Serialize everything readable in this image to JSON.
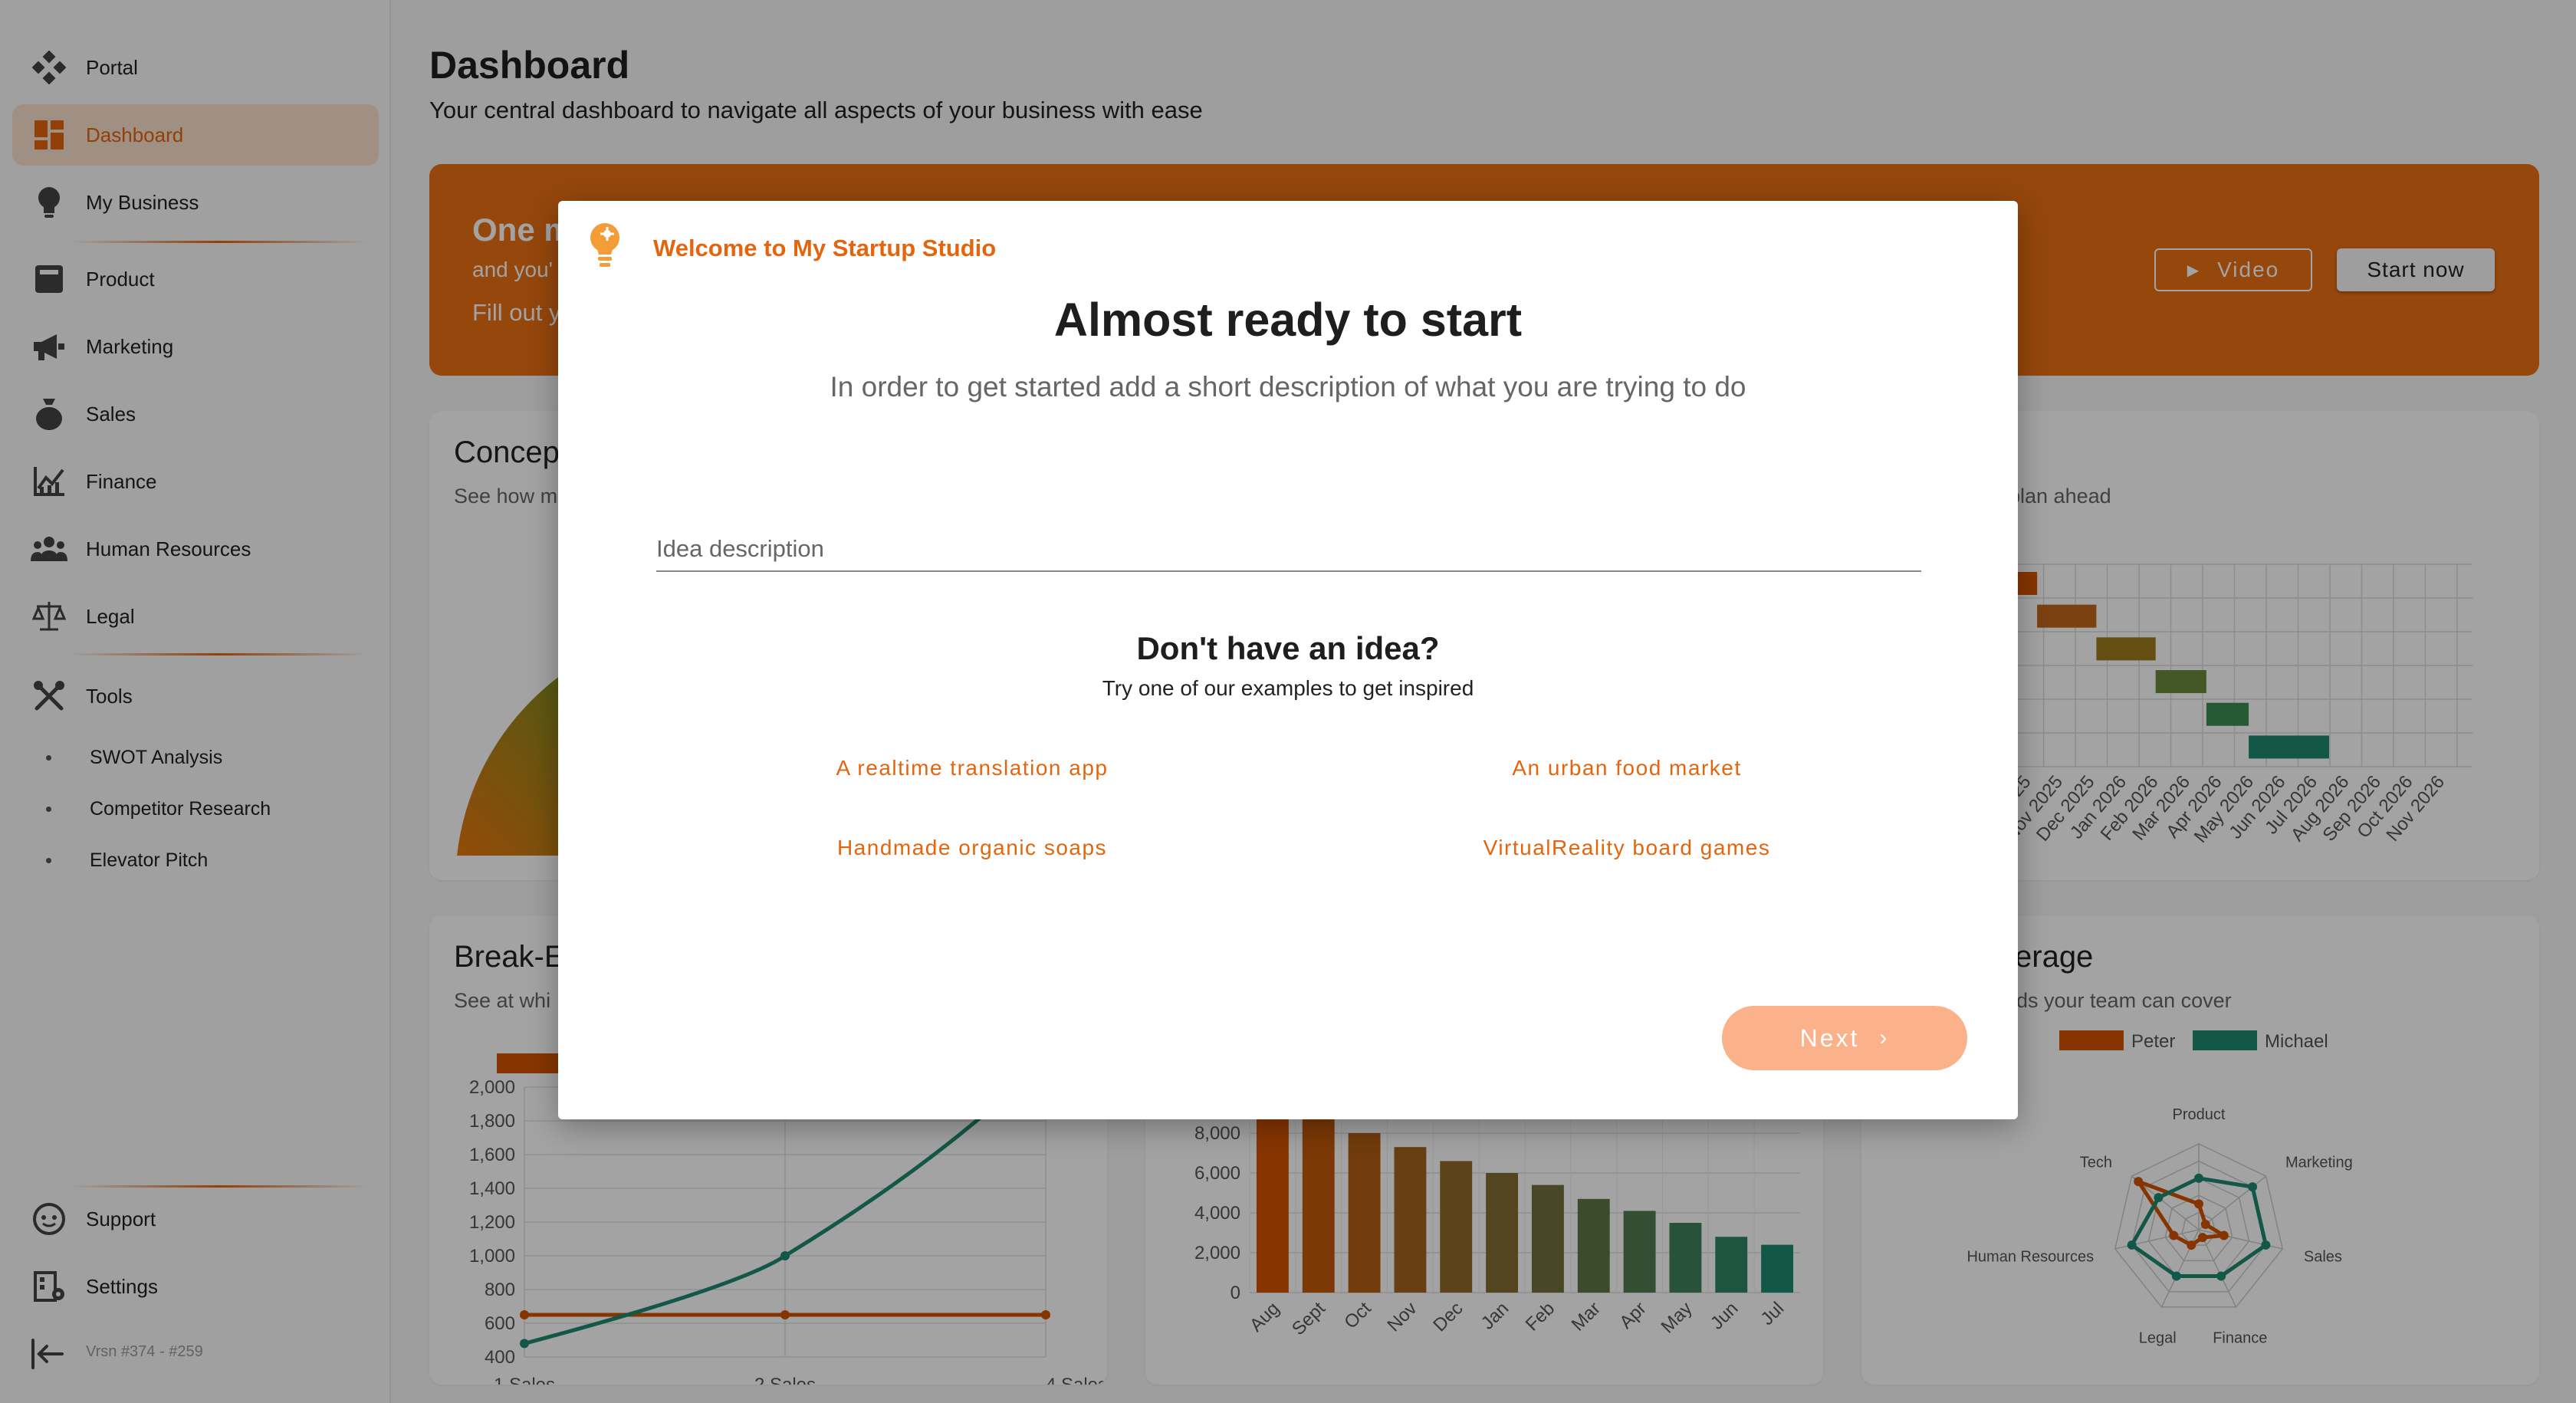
{
  "sidebar": {
    "items": [
      {
        "label": "Portal",
        "icon": "portal-icon"
      },
      {
        "label": "Dashboard",
        "icon": "dashboard-icon",
        "active": true
      },
      {
        "label": "My Business",
        "icon": "lightbulb-icon"
      },
      {
        "label": "Product",
        "icon": "product-icon"
      },
      {
        "label": "Marketing",
        "icon": "megaphone-icon"
      },
      {
        "label": "Sales",
        "icon": "money-bag-icon"
      },
      {
        "label": "Finance",
        "icon": "finance-chart-icon"
      },
      {
        "label": "Human Resources",
        "icon": "people-icon"
      },
      {
        "label": "Legal",
        "icon": "scales-icon"
      },
      {
        "label": "Tools",
        "icon": "tools-icon"
      }
    ],
    "tools": [
      "SWOT Analysis",
      "Competitor Research",
      "Elevator Pitch"
    ],
    "bottom": [
      {
        "label": "Support",
        "icon": "support-icon"
      },
      {
        "label": "Settings",
        "icon": "settings-icon"
      }
    ],
    "collapse_icon": "collapse-icon",
    "version": "Vrsn #374 - #259"
  },
  "header": {
    "title": "Dashboard",
    "subtitle": "Your central dashboard to navigate all aspects of your business with ease"
  },
  "banner": {
    "title": "One m",
    "line2": "and you'",
    "line3": "Fill out y",
    "video_label": "Video",
    "start_label": "Start now"
  },
  "cards": {
    "concept": {
      "title": "Concep",
      "subtitle": "See how m"
    },
    "timeline": {
      "subtitle": "plan ahead",
      "months": [
        "025",
        "Nov 2025",
        "Dec 2025",
        "Jan 2026",
        "Feb 2026",
        "Mar 2026",
        "Apr 2026",
        "May 2026",
        "Jun 2026",
        "Jul 2026",
        "Aug 2026",
        "Sep 2026",
        "Oct 2026",
        "Nov 2026"
      ]
    },
    "breakeven": {
      "title": "Break-E",
      "subtitle": "See at whi"
    },
    "coverage": {
      "title": "verage",
      "subtitle": "lds your team can cover"
    }
  },
  "chart_data": [
    {
      "type": "line",
      "categories": [
        "1 Sales",
        "2 Sales",
        "4 Sales"
      ],
      "yticks": [
        "2,000",
        "1,800",
        "1,600",
        "1,400",
        "1,200",
        "1,000",
        "800",
        "600",
        "400"
      ],
      "ylim": [
        400,
        2000
      ],
      "series": [
        {
          "values": [
            650,
            650,
            650
          ],
          "color": "#d35400"
        },
        {
          "values": [
            480,
            1000,
            2000
          ],
          "color": "#1f8a70"
        }
      ]
    },
    {
      "type": "bar",
      "categories": [
        "Aug",
        "Sept",
        "Oct",
        "Nov",
        "Dec",
        "Jan",
        "Feb",
        "Mar",
        "Apr",
        "May",
        "Jun",
        "Jul"
      ],
      "yticks": [
        "8,000",
        "6,000",
        "4,000",
        "2,000",
        "0"
      ],
      "ylim": [
        0,
        8000
      ],
      "values": [
        9000,
        9000,
        8000,
        7300,
        6600,
        6000,
        5400,
        4700,
        4100,
        3500,
        2800,
        2400
      ]
    },
    {
      "type": "radar",
      "axes": [
        "Product",
        "Marketing",
        "Sales",
        "Finance",
        "Legal",
        "Human Resources",
        "Tech"
      ],
      "series": [
        {
          "name": "Peter",
          "values": [
            0.3,
            0.1,
            0.3,
            0.1,
            0.2,
            0.3,
            0.9
          ],
          "color": "#d35400"
        },
        {
          "name": "Michael",
          "values": [
            0.6,
            0.8,
            0.8,
            0.6,
            0.6,
            0.8,
            0.6
          ],
          "color": "#1f8a70"
        }
      ]
    }
  ],
  "modal": {
    "welcome": "Welcome to My Startup Studio",
    "title": "Almost ready to start",
    "subtitle": "In order to get started add a short description of what you are trying to do",
    "input_placeholder": "Idea description",
    "no_idea_title": "Don't have an idea?",
    "no_idea_subtitle": "Try one of our examples to get inspired",
    "examples": [
      "A realtime translation app",
      "An urban food market",
      "Handmade organic soaps",
      "VirtualReality board games"
    ],
    "next_label": "Next"
  },
  "colors": {
    "accent": "#e5650e",
    "banner": "#e96f14",
    "teal": "#1f8a70",
    "next_button": "#fbb28a"
  }
}
